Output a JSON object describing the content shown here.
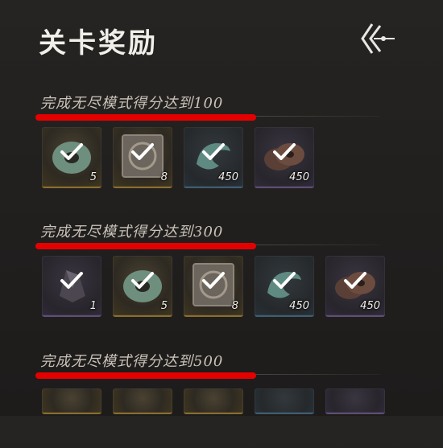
{
  "header": {
    "title": "关卡奖励",
    "back_icon": "back-arrow-icon"
  },
  "sections": [
    {
      "title": "完成无尽模式得分达到100",
      "items": [
        {
          "icon": "jade-ring-icon",
          "count": "5",
          "tint": "gold"
        },
        {
          "icon": "bronze-plaque-icon",
          "count": "8",
          "tint": "gold"
        },
        {
          "icon": "jade-swirl-icon",
          "count": "450",
          "tint": "blue"
        },
        {
          "icon": "coins-icon",
          "count": "450",
          "tint": "purple"
        }
      ]
    },
    {
      "title": "完成无尽模式得分达到300",
      "items": [
        {
          "icon": "dark-shard-icon",
          "count": "1",
          "tint": "purple"
        },
        {
          "icon": "jade-ring-icon",
          "count": "5",
          "tint": "gold"
        },
        {
          "icon": "bronze-plaque-icon",
          "count": "8",
          "tint": "gold"
        },
        {
          "icon": "jade-swirl-icon",
          "count": "450",
          "tint": "blue"
        },
        {
          "icon": "coins-icon",
          "count": "450",
          "tint": "purple"
        }
      ]
    },
    {
      "title": "完成无尽模式得分达到500",
      "items": []
    }
  ],
  "colors": {
    "highlight": "#e50000",
    "claimed_check": "#ffffff"
  }
}
